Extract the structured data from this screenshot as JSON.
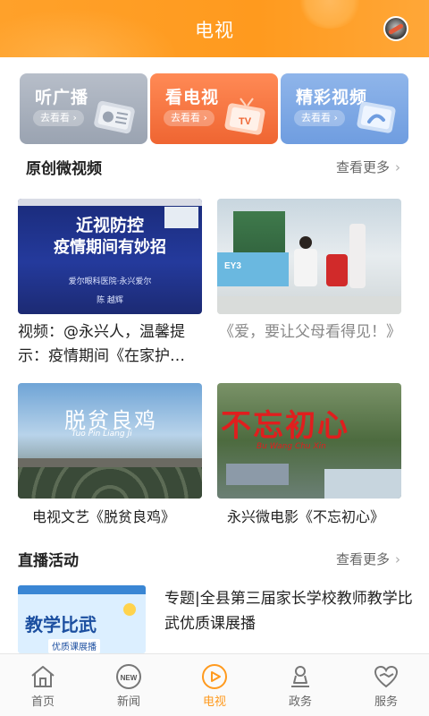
{
  "header": {
    "title": "电视"
  },
  "features": [
    {
      "name": "听广播",
      "go": "去看看 ›"
    },
    {
      "name": "看电视",
      "go": "去看看 ›"
    },
    {
      "name": "精彩视频",
      "go": "去看看 ›"
    }
  ],
  "original": {
    "title": "原创微视频",
    "more": "查看更多",
    "videos": [
      {
        "thumb_title_1": "近视防控",
        "thumb_title_2": "疫情期间有妙招",
        "thumb_sub": "爱尔眼科医院·永兴爱尔",
        "thumb_name": "陈 越辉",
        "caption": "视频：@永兴人，温馨提示：疫情期间《在家护…"
      },
      {
        "thumb_sign": "EY3",
        "caption": "《爱，要让父母看得见！》"
      },
      {
        "thumb_title": "脱贫良鸡",
        "thumb_sub": "Tuo Pin Liang Ji",
        "caption": "电视文艺《脱贫良鸡》"
      },
      {
        "thumb_title": "不忘初心",
        "thumb_sub": "Bu Wang Chu Xin",
        "caption": "永兴微电影《不忘初心》"
      }
    ]
  },
  "live": {
    "title": "直播活动",
    "more": "查看更多",
    "item": {
      "thumb_title": "教学比武",
      "thumb_sub": "优质课展播",
      "title": "专题|全县第三届家长学校教师教学比武优质课展播"
    }
  },
  "tabs": [
    {
      "label": "首页",
      "icon": "home-icon"
    },
    {
      "label": "新闻",
      "icon": "news-icon",
      "badge": "NEW"
    },
    {
      "label": "电视",
      "icon": "tv-play-icon",
      "active": true
    },
    {
      "label": "政务",
      "icon": "government-icon"
    },
    {
      "label": "服务",
      "icon": "service-icon"
    }
  ],
  "colors": {
    "accent": "#ff9a1e",
    "header": "#ffa12a"
  }
}
